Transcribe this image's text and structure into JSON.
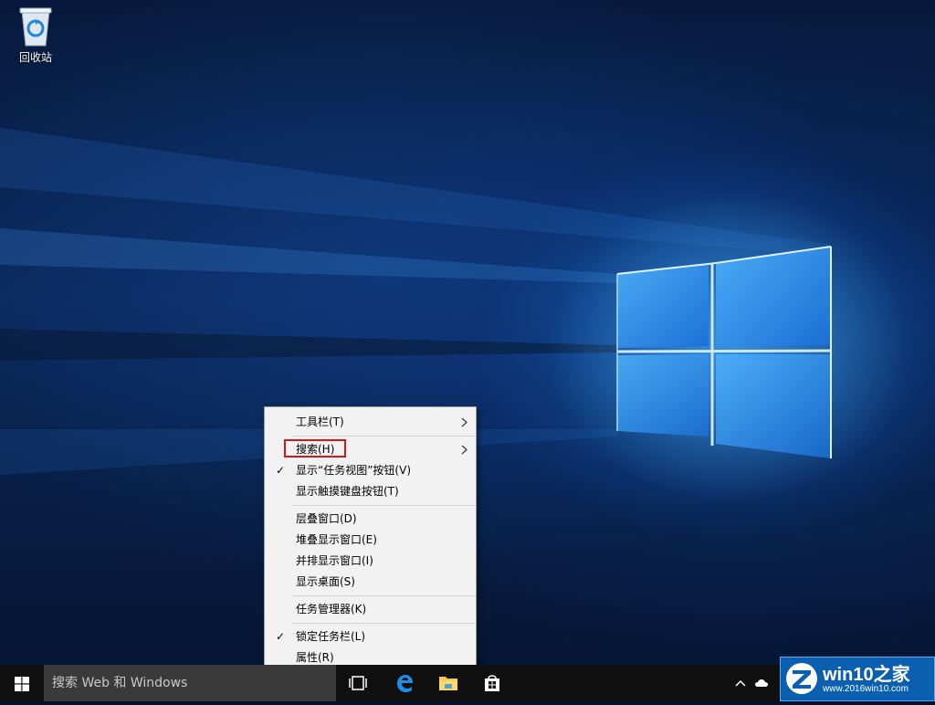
{
  "desktop": {
    "icons": [
      {
        "label": "回收站",
        "icon": "recycle-bin-icon"
      }
    ]
  },
  "context_menu": {
    "items": [
      {
        "label": "工具栏(T)",
        "checked": false,
        "submenu": true
      },
      {
        "label": "搜索(H)",
        "checked": false,
        "submenu": true,
        "highlighted": true
      },
      {
        "label": "显示“任务视图”按钮(V)",
        "checked": true,
        "submenu": false
      },
      {
        "label": "显示触摸键盘按钮(T)",
        "checked": false,
        "submenu": false
      },
      {
        "label": "层叠窗口(D)",
        "checked": false,
        "submenu": false
      },
      {
        "label": "堆叠显示窗口(E)",
        "checked": false,
        "submenu": false
      },
      {
        "label": "并排显示窗口(I)",
        "checked": false,
        "submenu": false
      },
      {
        "label": "显示桌面(S)",
        "checked": false,
        "submenu": false
      },
      {
        "label": "任务管理器(K)",
        "checked": false,
        "submenu": false
      },
      {
        "label": "锁定任务栏(L)",
        "checked": true,
        "submenu": false
      },
      {
        "label": "属性(R)",
        "checked": false,
        "submenu": false
      }
    ],
    "check_mark": "✓",
    "highlight_color": "#d01a1a"
  },
  "taskbar": {
    "search_placeholder": "搜索 Web 和 Windows",
    "pinned": [
      {
        "name": "task-view-icon"
      },
      {
        "name": "edge-icon"
      },
      {
        "name": "file-explorer-icon"
      },
      {
        "name": "store-icon"
      }
    ],
    "background": "#101010"
  },
  "watermark": {
    "title": "win10之家",
    "url": "www.2016win10.com"
  }
}
